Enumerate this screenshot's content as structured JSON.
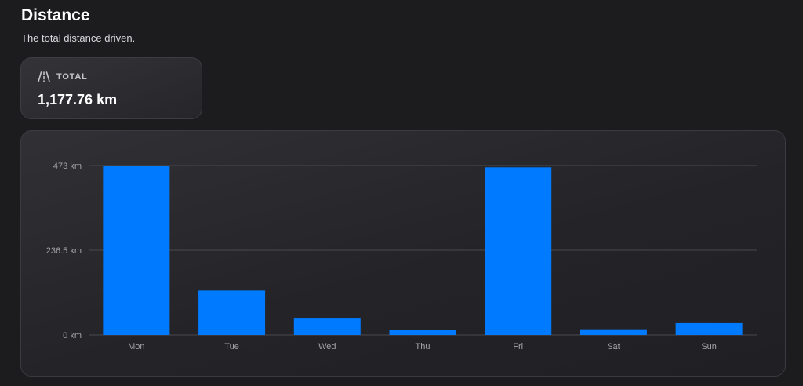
{
  "header": {
    "title": "Distance",
    "subtitle": "The total distance driven."
  },
  "stat": {
    "icon": "road-icon",
    "label": "TOTAL",
    "value": "1,177.76 km"
  },
  "colors": {
    "bar": "#007aff",
    "grid": "#48484e",
    "background": "#1c1c1f"
  },
  "chart_data": {
    "type": "bar",
    "categories": [
      "Mon",
      "Tue",
      "Wed",
      "Thu",
      "Fri",
      "Sat",
      "Sun"
    ],
    "values": [
      473,
      124,
      48,
      15,
      468,
      16,
      33
    ],
    "unit": "km",
    "ylim": [
      0,
      473
    ],
    "yticks": [
      {
        "value": 0,
        "label": "0 km"
      },
      {
        "value": 236.5,
        "label": "236.5 km"
      },
      {
        "value": 473,
        "label": "473 km"
      }
    ],
    "grid": true,
    "legend": "none"
  }
}
